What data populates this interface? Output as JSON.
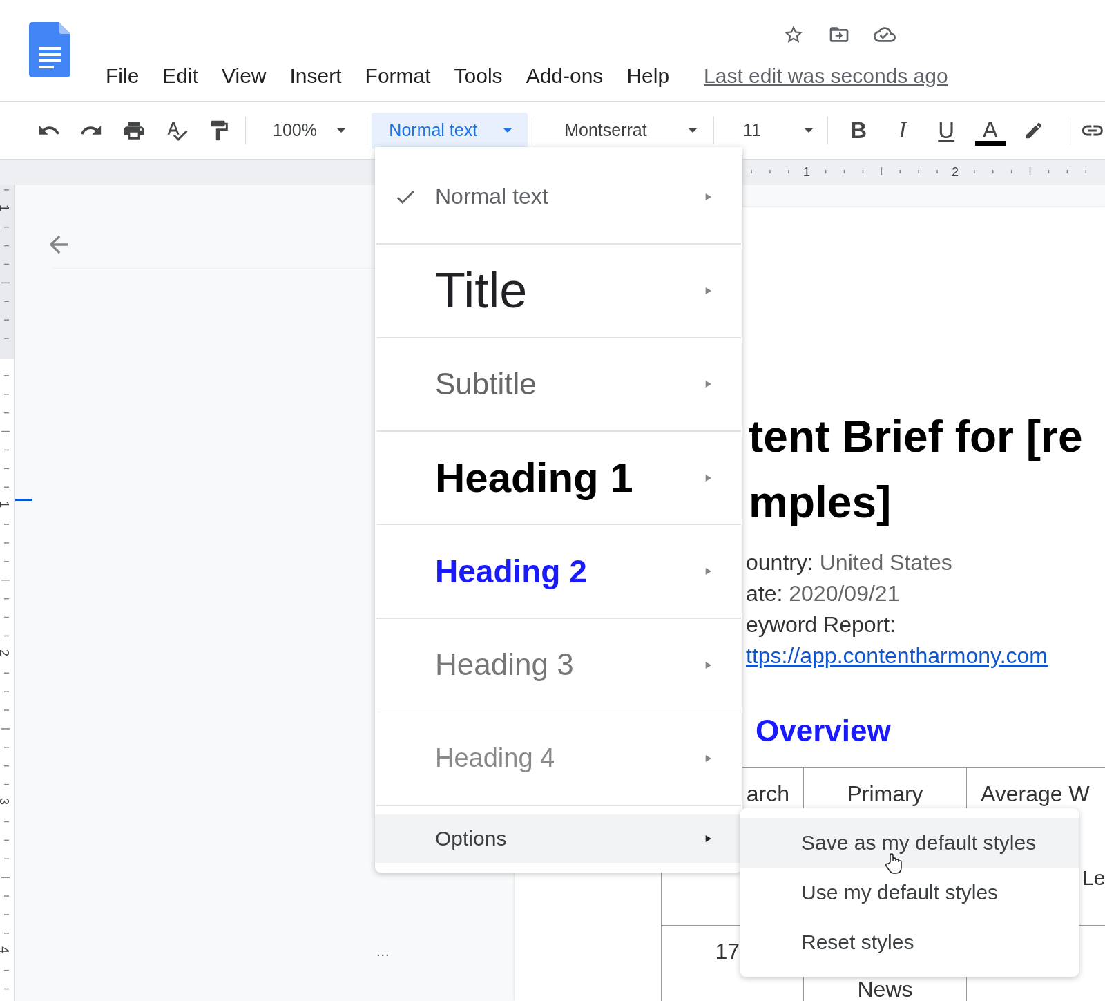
{
  "header": {
    "menus": [
      "File",
      "Edit",
      "View",
      "Insert",
      "Format",
      "Tools",
      "Add-ons",
      "Help"
    ],
    "last_edit": "Last edit was seconds ago"
  },
  "toolbar": {
    "zoom": "100%",
    "style": "Normal text",
    "font": "Montserrat",
    "size": "11",
    "format": [
      {
        "label": "B",
        "kind": "bold"
      },
      {
        "label": "I",
        "kind": "italic"
      },
      {
        "label": "U",
        "kind": "underline"
      },
      {
        "label": "A",
        "kind": "text_color"
      }
    ]
  },
  "rulers": {
    "horizontal": [
      "1",
      "2"
    ],
    "vertical": [
      "1",
      "1",
      "2",
      "3",
      "4"
    ]
  },
  "outline": {
    "overflow": "..."
  },
  "document": {
    "title_lines": [
      "tent Brief for [re",
      "mples]"
    ],
    "meta": [
      {
        "label": "ountry:",
        "value": "United States"
      },
      {
        "label": "ate:",
        "value": "2020/09/21"
      },
      {
        "label": "eyword Report:"
      }
    ],
    "link": "ttps://app.contentharmony.com",
    "section_heading": "Overview",
    "table": {
      "header": [
        "arch",
        "Primary",
        "Average W"
      ],
      "header_continued": "Le",
      "row": [
        "17",
        "News"
      ]
    }
  },
  "style_menu": {
    "items": [
      {
        "label": "Normal text",
        "kind": "normal",
        "checked": true
      },
      {
        "label": "Title",
        "kind": "title",
        "checked": false
      },
      {
        "label": "Subtitle",
        "kind": "subtitle",
        "checked": false
      },
      {
        "label": "Heading 1",
        "kind": "heading1",
        "checked": false
      },
      {
        "label": "Heading 2",
        "kind": "heading2",
        "checked": false
      },
      {
        "label": "Heading 3",
        "kind": "heading3",
        "checked": false
      },
      {
        "label": "Heading 4",
        "kind": "heading4",
        "checked": false
      }
    ],
    "options": {
      "label": "Options",
      "highlighted": true
    }
  },
  "options_submenu": [
    {
      "label": "Save as my default styles",
      "selected": true
    },
    {
      "label": "Use my default styles",
      "selected": false
    },
    {
      "label": "Reset styles",
      "selected": false
    }
  ]
}
